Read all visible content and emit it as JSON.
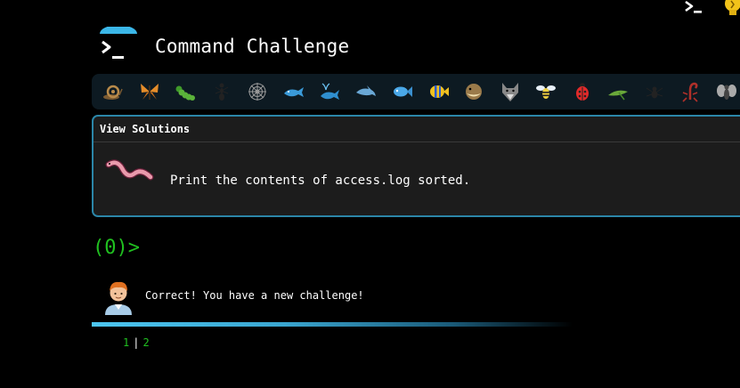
{
  "header": {
    "title": "Command Challenge",
    "logo_icon": "terminal-prompt-icon",
    "top_right_icons": [
      "terminal-icon",
      "lightbulb-icon"
    ]
  },
  "critters": [
    {
      "name": "snail",
      "color": "#8a6a3a"
    },
    {
      "name": "butterfly",
      "color": "#e48c2a"
    },
    {
      "name": "caterpillar",
      "color": "#5bb33a"
    },
    {
      "name": "ant",
      "color": "#1a1a1a"
    },
    {
      "name": "spider-web",
      "color": "#aaaaaa"
    },
    {
      "name": "whale",
      "color": "#3a9ad8"
    },
    {
      "name": "spouting-whale",
      "color": "#2f8fcf"
    },
    {
      "name": "dolphin",
      "color": "#6aa8d6"
    },
    {
      "name": "fish",
      "color": "#4aa8e8"
    },
    {
      "name": "tropical-fish",
      "color": "#f0c020"
    },
    {
      "name": "blowfish",
      "color": "#9a7a4a"
    },
    {
      "name": "wolf",
      "color": "#888888"
    },
    {
      "name": "bee",
      "color": "#f0d040"
    },
    {
      "name": "ladybug",
      "color": "#e02a2a"
    },
    {
      "name": "cricket",
      "color": "#6aa83a"
    },
    {
      "name": "spider",
      "color": "#1a1a1a"
    },
    {
      "name": "scorpion",
      "color": "#b0302a"
    },
    {
      "name": "fly",
      "color": "#999999"
    }
  ],
  "panel": {
    "header": "View Solutions",
    "challenge": "Print the contents of access.log sorted.",
    "icon": "worm-icon"
  },
  "prompt": "(0)>",
  "feedback": {
    "avatar_icon": "person-avatar-icon",
    "message": "Correct! You have a new challenge!"
  },
  "pager": {
    "pages": [
      "1",
      "2"
    ],
    "separator": "|"
  },
  "colors": {
    "background": "#000000",
    "accent": "#2b86a8",
    "prompt_green": "#20c020",
    "panel_bg": "#1c1c1c"
  }
}
